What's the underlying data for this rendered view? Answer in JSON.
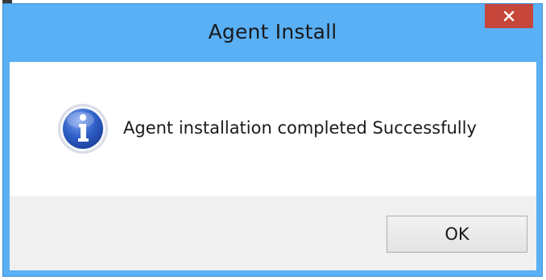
{
  "window": {
    "title": "Agent Install",
    "close_icon": "close-icon"
  },
  "dialog": {
    "icon": "info-icon",
    "message": "Agent installation completed Successfully"
  },
  "buttons": {
    "ok_label": "OK"
  },
  "colors": {
    "titlebar": "#5ab0f5",
    "close_button": "#c7463b",
    "footer": "#f0f0f0"
  }
}
